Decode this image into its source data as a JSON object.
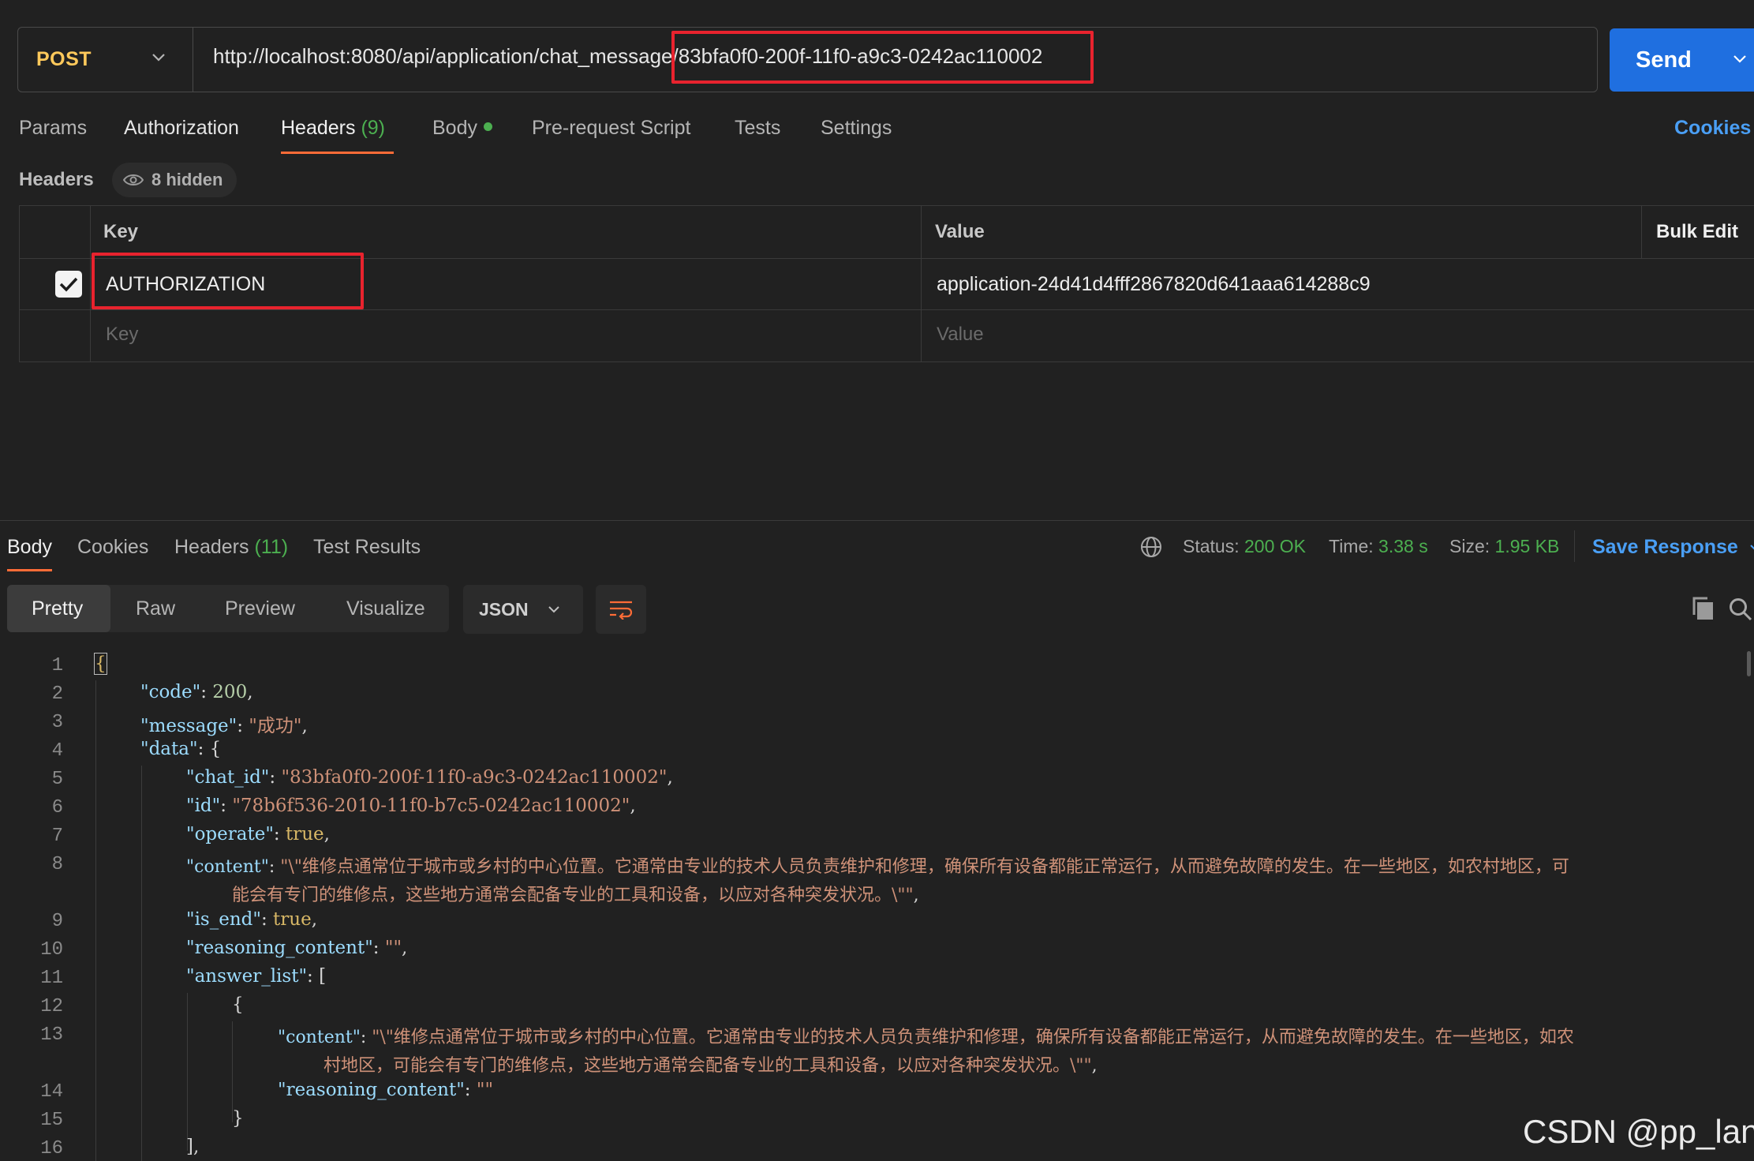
{
  "request": {
    "method": "POST",
    "url_prefix": "http://localhost:8080/api/application/chat_message",
    "url_id": "/83bfa0f0-200f-11f0-a9c3-0242ac110002",
    "send_label": "Send"
  },
  "request_tabs": {
    "params": "Params",
    "authorization": "Authorization",
    "headers": "Headers",
    "headers_count": "(9)",
    "body": "Body",
    "prerequest": "Pre-request Script",
    "tests": "Tests",
    "settings": "Settings",
    "cookies": "Cookies"
  },
  "headers_section": {
    "label": "Headers",
    "hidden": "8 hidden",
    "col_key": "Key",
    "col_value": "Value",
    "bulk_edit": "Bulk Edit",
    "rows": [
      {
        "key": "AUTHORIZATION",
        "value": "application-24d41d4fff2867820d641aaa614288c9"
      }
    ],
    "key_placeholder": "Key",
    "value_placeholder": "Value"
  },
  "response_tabs": {
    "body": "Body",
    "cookies": "Cookies",
    "headers": "Headers",
    "headers_count": "(11)",
    "test_results": "Test Results"
  },
  "response_status": {
    "status_label": "Status:",
    "status_value": "200 OK",
    "time_label": "Time:",
    "time_value": "3.38 s",
    "size_label": "Size:",
    "size_value": "1.95 KB",
    "save_response": "Save Response"
  },
  "view_modes": {
    "pretty": "Pretty",
    "raw": "Raw",
    "preview": "Preview",
    "visualize": "Visualize",
    "format": "JSON"
  },
  "code": {
    "line_numbers": [
      "1",
      "2",
      "3",
      "4",
      "5",
      "6",
      "7",
      "8",
      "9",
      "10",
      "11",
      "12",
      "13",
      "14",
      "15",
      "16"
    ],
    "l1": "{",
    "l2_key": "\"code\"",
    "l2_val": "200",
    "l3_key": "\"message\"",
    "l3_val": "\"成功\"",
    "l4_key": "\"data\"",
    "l4_open": "{",
    "l5_key": "\"chat_id\"",
    "l5_val": "\"83bfa0f0-200f-11f0-a9c3-0242ac110002\"",
    "l6_key": "\"id\"",
    "l6_val": "\"78b6f536-2010-11f0-b7c5-0242ac110002\"",
    "l7_key": "\"operate\"",
    "l7_val": "true",
    "l8_key": "\"content\"",
    "l8_val_a": "\"\\\"维修点通常位于城市或乡村的中心位置。它通常由专业的技术人员负责维护和修理，确保所有设备都能正常运行，从而避免故障的发生。在一些地区，如农村地区，可",
    "l8_val_b": "能会有专门的维修点，这些地方通常会配备专业的工具和设备，以应对各种突发状况。\\\"\"",
    "l9_key": "\"is_end\"",
    "l9_val": "true",
    "l10_key": "\"reasoning_content\"",
    "l10_val": "\"\"",
    "l11_key": "\"answer_list\"",
    "l11_open": "[",
    "l12": "{",
    "l13_key": "\"content\"",
    "l13_val_a": "\"\\\"维修点通常位于城市或乡村的中心位置。它通常由专业的技术人员负责维护和修理，确保所有设备都能正常运行，从而避免故障的发生。在一些地区，如农",
    "l13_val_b": "村地区，可能会有专门的维修点，这些地方通常会配备专业的工具和设备，以应对各种突发状况。\\\"\"",
    "l14_key": "\"reasoning_content\"",
    "l14_val": "\"\"",
    "l15": "}",
    "l16": "],"
  },
  "watermark": "CSDN @pp_lan"
}
